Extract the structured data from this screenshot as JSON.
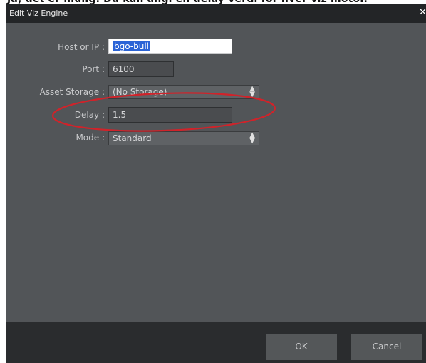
{
  "window": {
    "title": "Edit Viz Engine",
    "close_icon": "close-icon"
  },
  "form": {
    "host": {
      "label": "Host or IP :",
      "value": "bgo-bull"
    },
    "port": {
      "label": "Port :",
      "value": "6100"
    },
    "asset_storage": {
      "label": "Asset Storage :",
      "value": "(No Storage)"
    },
    "delay": {
      "label": "Delay :",
      "value": "1.5"
    },
    "mode": {
      "label": "Mode :",
      "value": "Standard"
    }
  },
  "footer": {
    "ok_label": "OK",
    "cancel_label": "Cancel"
  },
  "colors": {
    "dialog_bg": "#525558",
    "titlebar_bg": "#232527",
    "footer_bg": "#2a2c2e",
    "highlight_ellipse": "#d0232a",
    "selection": "#2b64d6"
  }
}
